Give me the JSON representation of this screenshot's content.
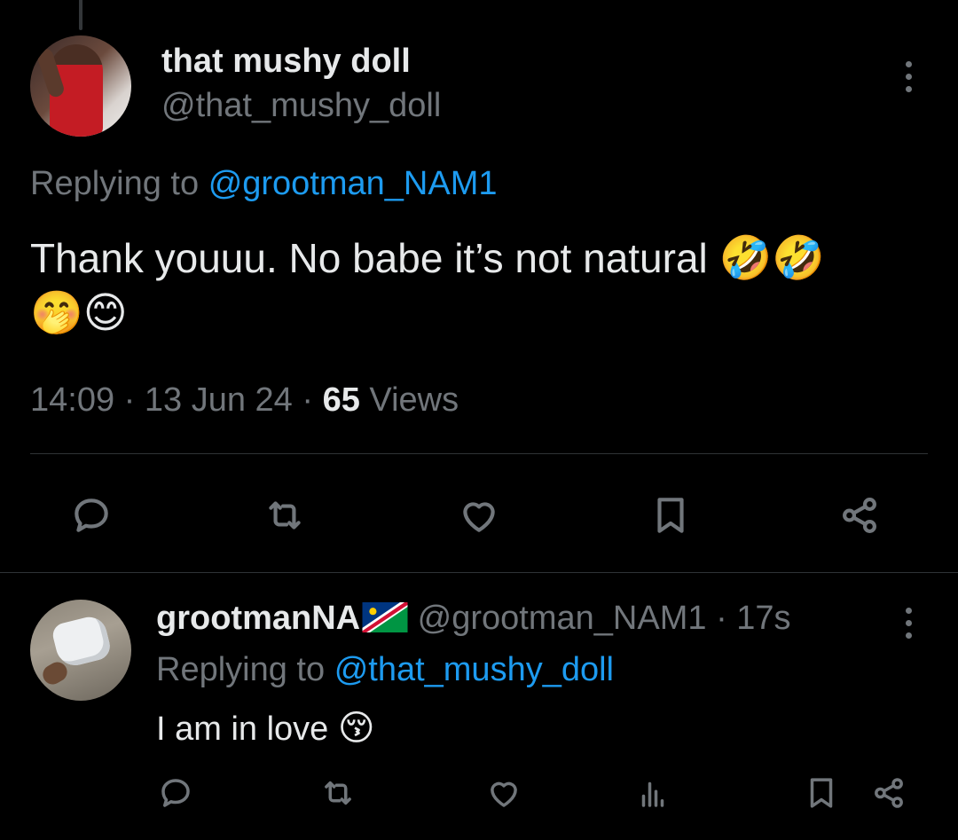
{
  "main_tweet": {
    "display_name": "that mushy doll",
    "handle": "@that_mushy_doll",
    "replying_prefix": "Replying to",
    "replying_to": "@grootman_NAM1",
    "text": "Thank youuu. No babe it’s not natural",
    "text_emojis": "🤣🤣",
    "text_emojis_line2": "🤭😊",
    "time": "14:09",
    "date": "13 Jun 24",
    "views_count": "65",
    "views_label": "Views"
  },
  "main_actions": [
    "reply-icon",
    "retweet-icon",
    "like-icon",
    "bookmark-icon",
    "share-icon"
  ],
  "reply_tweet": {
    "display_name": "grootmanNA",
    "flag": "Namibia flag",
    "handle": "@grootman_NAM1",
    "separator": "·",
    "time": "17s",
    "replying_prefix": "Replying to",
    "replying_to": "@that_mushy_doll",
    "text": "I am in love",
    "text_emoji": "😚"
  },
  "reply_actions": [
    "reply-icon",
    "retweet-icon",
    "like-icon",
    "views-icon",
    "bookmark-icon",
    "share-icon"
  ],
  "colors": {
    "background": "#000000",
    "text_primary": "#e7e9ea",
    "text_secondary": "#71767b",
    "link": "#1d9bf0",
    "divider": "#2f3336"
  }
}
